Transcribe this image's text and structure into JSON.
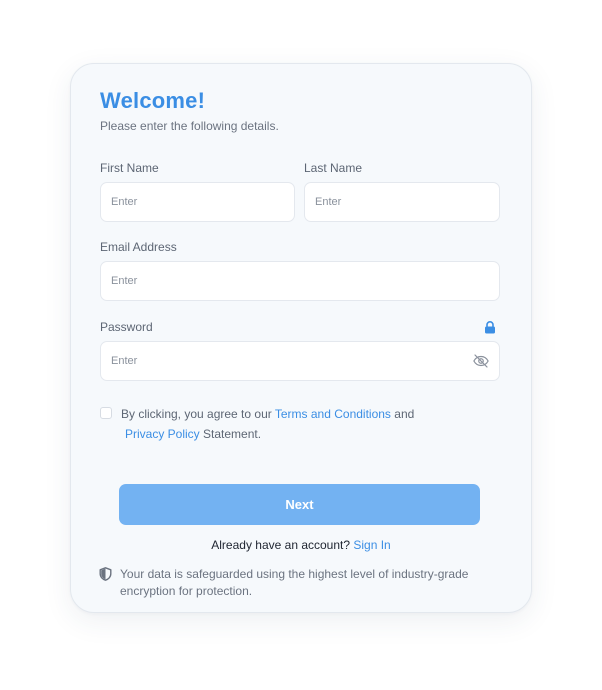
{
  "form": {
    "title": "Welcome!",
    "subtitle": "Please enter the following details.",
    "first_name": {
      "label": "First Name",
      "placeholder": "Enter",
      "value": ""
    },
    "last_name": {
      "label": "Last Name",
      "placeholder": "Enter",
      "value": ""
    },
    "email": {
      "label": "Email Address",
      "placeholder": "Enter",
      "value": ""
    },
    "password": {
      "label": "Password",
      "placeholder": "Enter",
      "value": ""
    },
    "terms": {
      "checked": false,
      "prefix": "By clicking, you agree to our",
      "terms_link": "Terms and Conditions",
      "middle": "and",
      "privacy_link": "Privacy Policy",
      "suffix": "Statement."
    },
    "next_label": "Next",
    "signin_prompt": "Already have an account?",
    "signin_link": "Sign In",
    "security_note": "Your data is safeguarded using the highest level of industry-grade encryption for protection."
  },
  "icons": {
    "lock": "lock-icon",
    "eye": "eye-off-icon",
    "shield": "shield-icon"
  },
  "colors": {
    "accent": "#3b8ee4",
    "button": "#73b2f2",
    "card_bg": "#f6f9fc"
  }
}
